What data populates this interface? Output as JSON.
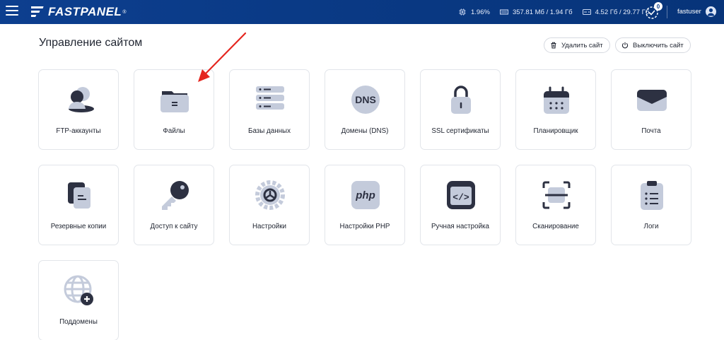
{
  "header": {
    "brand": "FASTPANEL",
    "brand_mark": "®",
    "stats": {
      "cpu": "1.96%",
      "ram": "357.81 Мб / 1.94 Гб",
      "disk": "4.52 Гб / 29.77 Гб"
    },
    "notifications_count": "0",
    "username": "fastuser"
  },
  "page": {
    "title": "Управление сайтом",
    "delete_site_label": "Удалить сайт",
    "disable_site_label": "Выключить сайт"
  },
  "tiles": [
    {
      "label": "FTP-аккаунты",
      "icon": "ftp-users-icon"
    },
    {
      "label": "Файлы",
      "icon": "folder-icon"
    },
    {
      "label": "Базы данных",
      "icon": "database-icon"
    },
    {
      "label": "Домены (DNS)",
      "icon": "dns-icon"
    },
    {
      "label": "SSL сертификаты",
      "icon": "lock-icon"
    },
    {
      "label": "Планировщик",
      "icon": "calendar-icon"
    },
    {
      "label": "Почта",
      "icon": "mail-icon"
    },
    {
      "label": "Резервные копии",
      "icon": "backup-icon"
    },
    {
      "label": "Доступ к сайту",
      "icon": "key-icon"
    },
    {
      "label": "Настройки",
      "icon": "gear-icon"
    },
    {
      "label": "Настройки PHP",
      "icon": "php-icon"
    },
    {
      "label": "Ручная настройка",
      "icon": "code-icon"
    },
    {
      "label": "Сканирование",
      "icon": "scan-icon"
    },
    {
      "label": "Логи",
      "icon": "logs-icon"
    },
    {
      "label": "Поддомены",
      "icon": "subdomain-globe-icon"
    }
  ],
  "icon_texts": {
    "dns": "DNS",
    "php": "php",
    "code": "</>"
  },
  "colors": {
    "header_bg": "#0a3a86",
    "icon_dark": "#2d3142",
    "icon_light": "#c4cbdb",
    "arrow": "#e5261f"
  }
}
